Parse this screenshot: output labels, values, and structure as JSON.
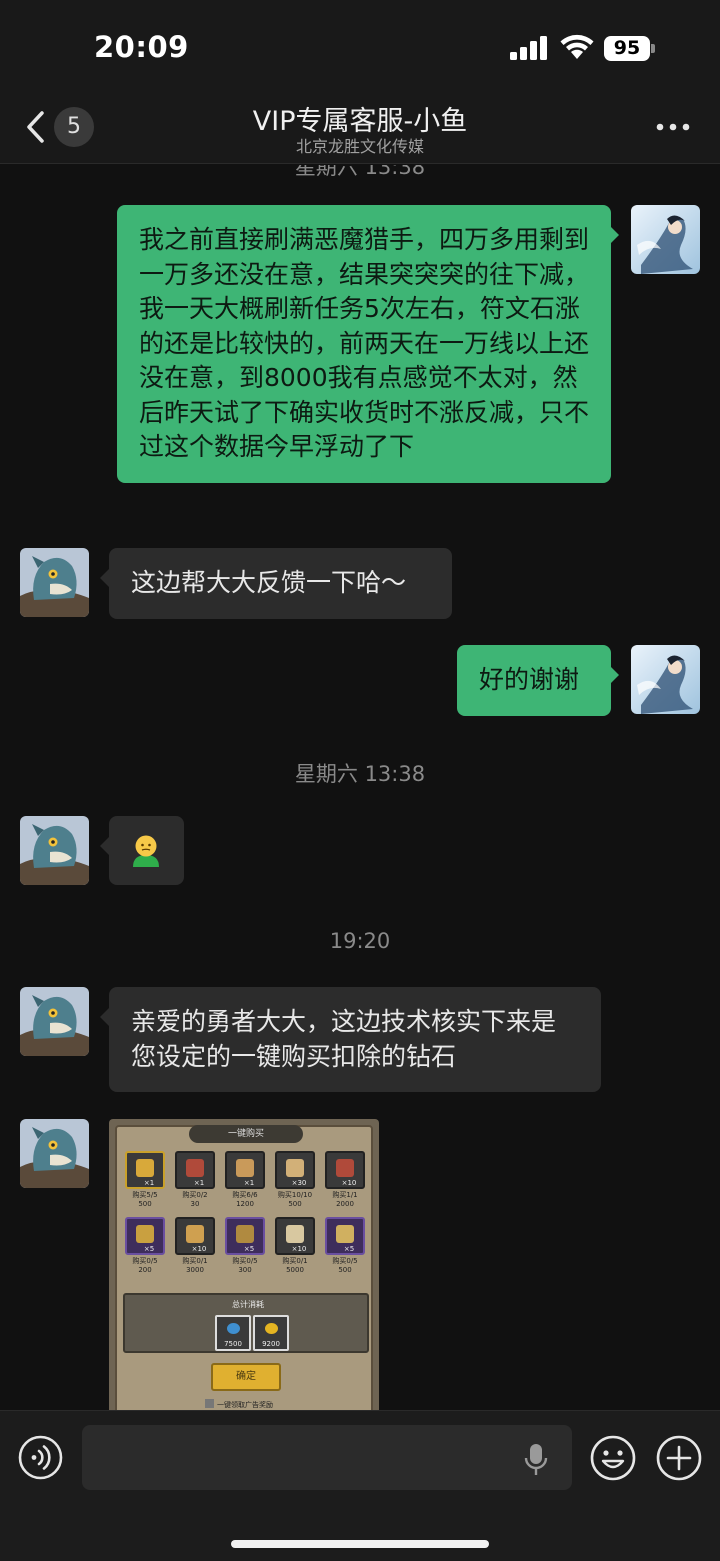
{
  "status_bar": {
    "time": "20:09",
    "battery": "95"
  },
  "header": {
    "back_badge": "5",
    "title": "VIP专属客服-小鱼",
    "subtitle": "北京龙胜文化传媒",
    "icons": [
      "chevron-left-icon",
      "more-icon"
    ]
  },
  "messages": {
    "partial_timestamp": "星期六 13:38",
    "m1_text": "我之前直接刷满恶魔猎手，四万多用剩到一万多还没在意，结果突突突的往下减，我一天大概刷新任务5次左右，符文石涨的还是比较快的，前两天在一万线以上还没在意，到8000我有点感觉不太对，然后昨天试了下确实收货时不涨反减，只不过这个数据今早浮动了下",
    "m2_text": "这边帮大大反馈一下哈～",
    "m3_text": "好的谢谢",
    "ts1": "星期六 13:38",
    "m4_emoji": "🫠",
    "ts2": "19:20",
    "m5_text": "亲爱的勇者大大，这边技术核实下来是您设定的一键购买扣除的钻石"
  },
  "game_screenshot": {
    "header": "一键购买",
    "items": [
      {
        "count": "×1",
        "label": "购买5/5",
        "price": "500",
        "style": "gold"
      },
      {
        "count": "×1",
        "label": "购买0/2",
        "price": "30",
        "style": "dark"
      },
      {
        "count": "×1",
        "label": "购买6/6",
        "price": "1200",
        "style": "dark"
      },
      {
        "count": "×30",
        "label": "购买10/10",
        "price": "500",
        "style": "dark"
      },
      {
        "count": "×10",
        "label": "购买1/1",
        "price": "2000",
        "style": "dark"
      },
      {
        "count": "×5",
        "label": "购买0/5",
        "price": "200",
        "style": "purple"
      },
      {
        "count": "×10",
        "label": "购买0/1",
        "price": "3000",
        "style": "dark"
      },
      {
        "count": "×5",
        "label": "购买0/5",
        "price": "300",
        "style": "purple"
      },
      {
        "count": "×10",
        "label": "购买0/1",
        "price": "5000",
        "style": "dark"
      },
      {
        "count": "×5",
        "label": "购买0/5",
        "price": "500",
        "style": "purple"
      }
    ],
    "total_title": "总计消耗",
    "total_diamond": "7500",
    "total_gold": "9200",
    "confirm_label": "确定",
    "checkbox_label": "一键领取广告奖励"
  },
  "input_bar": {
    "placeholder": "",
    "icons": [
      "voice-icon",
      "mic-icon",
      "emoji-icon",
      "plus-icon"
    ]
  },
  "colors": {
    "sent_bubble": "#3eb575",
    "received_bubble": "#2c2c2c",
    "background": "#111111"
  }
}
